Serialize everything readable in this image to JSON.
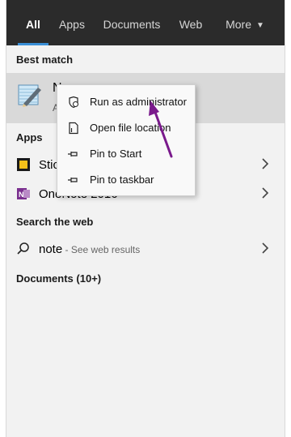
{
  "tabs": [
    {
      "label": "All"
    },
    {
      "label": "Apps"
    },
    {
      "label": "Documents"
    },
    {
      "label": "Web"
    },
    {
      "label": "More"
    }
  ],
  "sections": {
    "best_match": "Best match",
    "apps": "Apps",
    "search_web": "Search the web",
    "documents": "Documents (10+)"
  },
  "best_match": {
    "title_visible": "N",
    "subtitle_visible": "A"
  },
  "apps": [
    {
      "label_visible": "Stic"
    },
    {
      "label_visible": "OneNote 2016"
    }
  ],
  "web_result": {
    "query": "note",
    "suffix": " - See web results"
  },
  "context_menu": [
    {
      "label": "Run as administrator",
      "icon": "shield-icon"
    },
    {
      "label": "Open file location",
      "icon": "file-location-icon"
    },
    {
      "label": "Pin to Start",
      "icon": "pin-icon"
    },
    {
      "label": "Pin to taskbar",
      "icon": "pin-icon"
    }
  ],
  "colors": {
    "topbar": "#2b2b2b",
    "accent": "#3a8fd6",
    "annotation_arrow": "#7a1a8c"
  }
}
